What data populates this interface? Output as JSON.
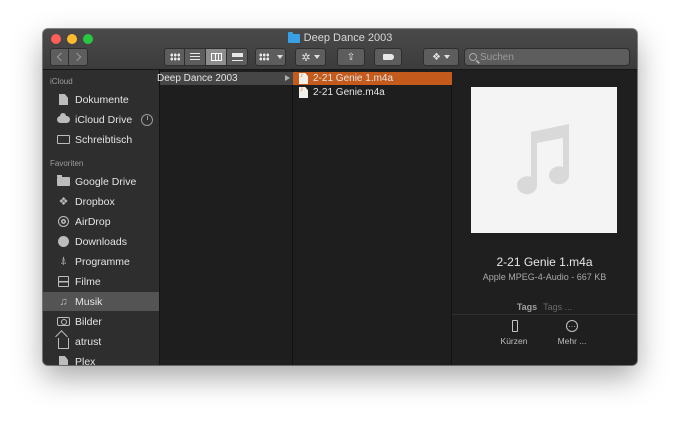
{
  "window": {
    "title": "Deep Dance 2003"
  },
  "toolbar": {
    "search_placeholder": "Suchen",
    "views": [
      "icon-view",
      "list-view",
      "column-view",
      "cover-flow-view"
    ],
    "active_view": "column-view"
  },
  "sidebar": {
    "sections": [
      {
        "header": "iCloud",
        "items": [
          {
            "label": "Dokumente",
            "icon": "document-icon"
          },
          {
            "label": "iCloud Drive",
            "icon": "cloud-icon"
          },
          {
            "label": "Schreibtisch",
            "icon": "desktop-icon"
          }
        ]
      },
      {
        "header": "Favoriten",
        "items": [
          {
            "label": "Google Drive",
            "icon": "folder-icon"
          },
          {
            "label": "Dropbox",
            "icon": "dropbox-icon"
          },
          {
            "label": "AirDrop",
            "icon": "airdrop-icon"
          },
          {
            "label": "Downloads",
            "icon": "download-icon"
          },
          {
            "label": "Programme",
            "icon": "apps-icon"
          },
          {
            "label": "Filme",
            "icon": "film-icon"
          },
          {
            "label": "Musik",
            "icon": "music-icon",
            "selected": true
          },
          {
            "label": "Bilder",
            "icon": "camera-icon"
          },
          {
            "label": "atrust",
            "icon": "home-icon"
          },
          {
            "label": "Plex",
            "icon": "document-icon"
          }
        ]
      }
    ]
  },
  "columns": {
    "folder": "Deep Dance 2003",
    "files": [
      {
        "name": "2-21 Genie 1.m4a",
        "selected": true
      },
      {
        "name": "2-21 Genie.m4a",
        "selected": false
      }
    ]
  },
  "preview": {
    "name": "2-21 Genie 1.m4a",
    "kind": "Apple MPEG-4-Audio - 667 KB",
    "tags_label": "Tags",
    "tags_placeholder": "Tags ...",
    "actions": [
      {
        "label": "Kürzen",
        "icon": "trim-icon"
      },
      {
        "label": "Mehr ...",
        "icon": "more-icon"
      }
    ]
  },
  "colors": {
    "selection": "#c45a1c",
    "folder": "#3aa0e5"
  }
}
